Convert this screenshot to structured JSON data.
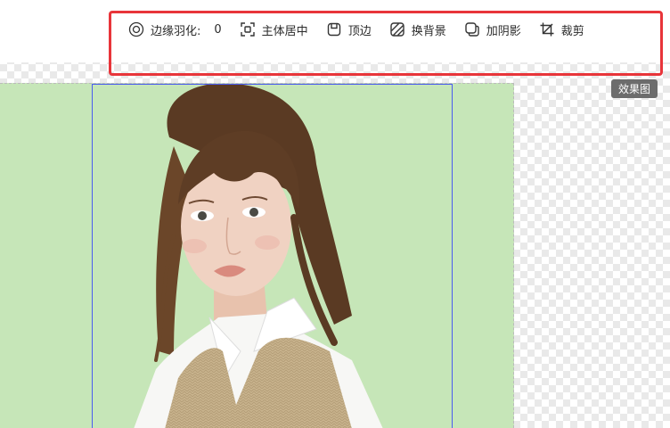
{
  "toolbar": {
    "feather": {
      "label": "边缘羽化:",
      "value": "0",
      "icon": "target-icon"
    },
    "center": {
      "label": "主体居中",
      "icon": "focus-frame-icon"
    },
    "top_edge": {
      "label": "顶边",
      "icon": "align-top-icon"
    },
    "bg": {
      "label": "换背景",
      "icon": "hatch-square-icon"
    },
    "shadow": {
      "label": "加阴影",
      "icon": "shadow-square-icon"
    },
    "crop": {
      "label": "裁剪",
      "icon": "crop-icon"
    }
  },
  "badge": {
    "label": "效果图"
  },
  "colors": {
    "highlight": "#e8353a",
    "canvas_bg": "#c6e6b8",
    "selection": "#4a5cf0"
  }
}
